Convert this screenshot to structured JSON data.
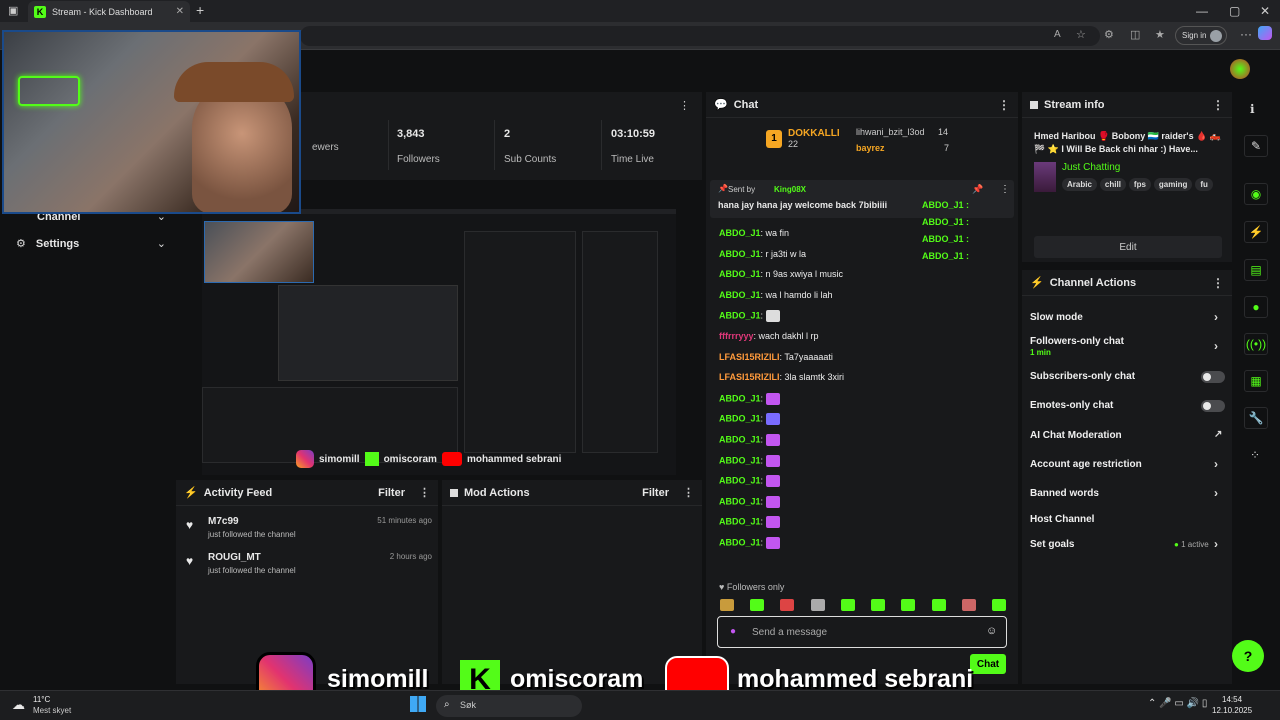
{
  "browser": {
    "tab_title": "Stream - Kick Dashboard",
    "new_tab": "+",
    "sign_in": "Sign in"
  },
  "stats": [
    {
      "value": "",
      "label": "ewers"
    },
    {
      "value": "3,843",
      "label": "Followers"
    },
    {
      "value": "2",
      "label": "Sub Counts"
    },
    {
      "value": "03:10:59",
      "label": "Time Live"
    }
  ],
  "sidebar": {
    "items": [
      {
        "label": "Channel"
      },
      {
        "label": "Settings"
      }
    ]
  },
  "preview_overlay": {
    "instagram": "simomill",
    "kick": "omiscoram",
    "youtube": "mohammed sebrani"
  },
  "activity_feed": {
    "title": "Activity Feed",
    "filter": "Filter",
    "items": [
      {
        "name": "M7c99",
        "action": "just followed the channel",
        "time": "51 minutes ago"
      },
      {
        "name": "ROUGI_MT",
        "action": "just followed the channel",
        "time": "2 hours ago"
      }
    ]
  },
  "mod_actions": {
    "title": "Mod Actions",
    "filter": "Filter"
  },
  "chat": {
    "title": "Chat",
    "top_gifters": [
      {
        "name": "DOKKALLI",
        "count": "22",
        "color": "#f5a623"
      },
      {
        "name": "lihwani_bzit_l3od",
        "count": "14",
        "color": "#cccccc"
      },
      {
        "name": "bayrez",
        "count": "7",
        "color": "#f5a623"
      }
    ],
    "pinned": {
      "sent_by_label": "Sent by",
      "sender": "King08X",
      "message": "hana jay hana jay welcome back 7bibiiii"
    },
    "side_names": [
      "ABDO_J1 :",
      "ABDO_J1 :",
      "ABDO_J1 :",
      "ABDO_J1 :"
    ],
    "messages": [
      {
        "user": "ABDO_J1",
        "text": "wa fin"
      },
      {
        "user": "ABDO_J1",
        "text": "r ja3ti w la"
      },
      {
        "user": "ABDO_J1",
        "text": "n 9as xwiya l music"
      },
      {
        "user": "ABDO_J1",
        "text": "wa l hamdo li lah"
      },
      {
        "user": "ABDO_J1",
        "text": ""
      },
      {
        "user": "fffrrryyy",
        "text": "wach dakhl l rp"
      },
      {
        "user": "LFASI15RIZILI",
        "text": "Ta7yaaaaati"
      },
      {
        "user": "LFASI15RIZILI",
        "text": "3la slamtk 3xiri"
      },
      {
        "user": "ABDO_J1",
        "text": ""
      },
      {
        "user": "ABDO_J1",
        "text": ""
      },
      {
        "user": "ABDO_J1",
        "text": ""
      },
      {
        "user": "ABDO_J1",
        "text": ""
      },
      {
        "user": "ABDO_J1",
        "text": ""
      },
      {
        "user": "ABDO_J1",
        "text": ""
      },
      {
        "user": "ABDO_J1",
        "text": ""
      },
      {
        "user": "ABDO_J1",
        "text": ""
      }
    ],
    "mode_label": "Followers only",
    "input_placeholder": "Send a message",
    "send_label": "Chat"
  },
  "stream_info": {
    "title": "Stream info",
    "stream_title": "Hmed Haribou 🥊 Bobony 🇸🇱 raider's 🩸 🛻 🏁 ⭐ I Will Be Back chi nhar :) Have...",
    "category": "Just Chatting",
    "tags": [
      "Arabic",
      "chill",
      "fps",
      "gaming",
      "fu"
    ],
    "edit": "Edit"
  },
  "channel_actions": {
    "title": "Channel Actions",
    "items": [
      {
        "label": "Slow mode",
        "sub": ""
      },
      {
        "label": "Followers-only chat",
        "sub": "1 min"
      },
      {
        "label": "Subscribers-only chat",
        "sub": ""
      },
      {
        "label": "Emotes-only chat",
        "sub": ""
      },
      {
        "label": "AI Chat Moderation",
        "sub": ""
      },
      {
        "label": "Account age restriction",
        "sub": ""
      },
      {
        "label": "Banned words",
        "sub": ""
      },
      {
        "label": "Host Channel",
        "sub": ""
      },
      {
        "label": "Set goals",
        "sub": "1 active"
      }
    ]
  },
  "overlay_socials": {
    "instagram": "simomill",
    "kick": "omiscoram",
    "youtube": "mohammed sebrani"
  },
  "taskbar": {
    "weather_temp": "11°C",
    "weather_desc": "Mest skyet",
    "search": "Søk",
    "time": "14:54",
    "date": "12.10.2025"
  },
  "colors": {
    "accent": "#53fc18",
    "panel": "#18191b",
    "bg": "#101112"
  }
}
